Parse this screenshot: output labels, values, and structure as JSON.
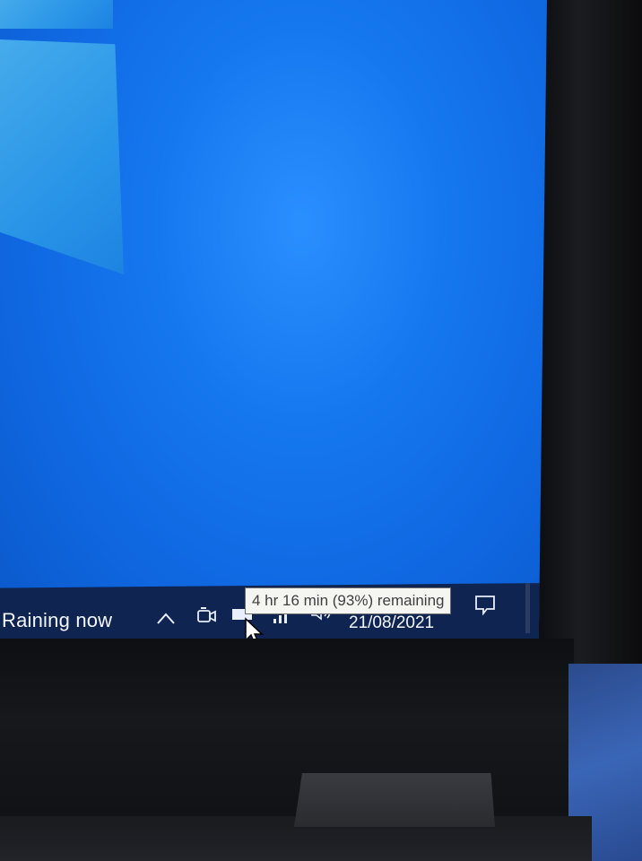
{
  "taskbar": {
    "weather_text": "Raining now",
    "date": "21/08/2021",
    "tray_icons": [
      "chevron-up-icon",
      "meet-now-icon",
      "battery-icon",
      "network-icon",
      "volume-icon",
      "notification-icon"
    ]
  },
  "tooltip": {
    "text": "4 hr 16 min (93%) remaining"
  },
  "battery": {
    "percent": 93
  }
}
